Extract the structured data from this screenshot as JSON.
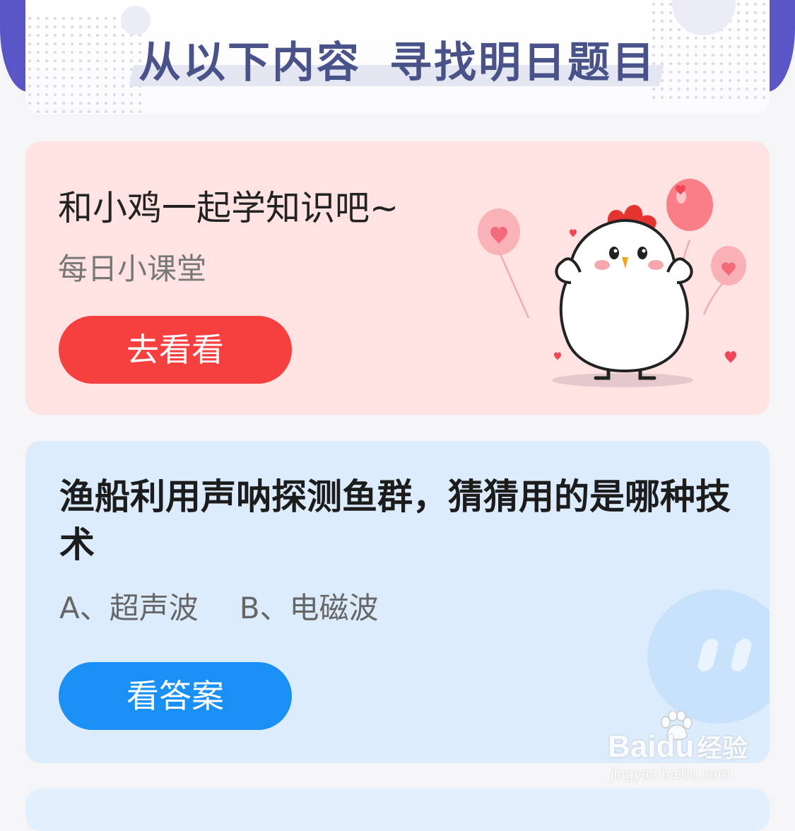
{
  "header": {
    "title_part1": "从以下内容",
    "title_part2": "寻找明日题目"
  },
  "lesson_card": {
    "title": "和小鸡一起学知识吧~",
    "subtitle": "每日小课堂",
    "button_label": "去看看",
    "background_color": "#ffe3e3",
    "button_color": "#f63f3f"
  },
  "question_card": {
    "question": "渔船利用声呐探测鱼群，猜猜用的是哪种技术",
    "option_a": "A、超声波",
    "option_b": "B、电磁波",
    "button_label": "看答案",
    "background_color": "#dcecfd",
    "button_color": "#1a8ff5"
  },
  "watermark": {
    "logo_prefix": "Bai",
    "logo_suffix": "du",
    "logo_cn": "经验",
    "url": "jingyan.baidu.com"
  },
  "icons": {
    "mascot": "chick-with-balloons-illustration",
    "decor": "cloud-blob-icon"
  }
}
